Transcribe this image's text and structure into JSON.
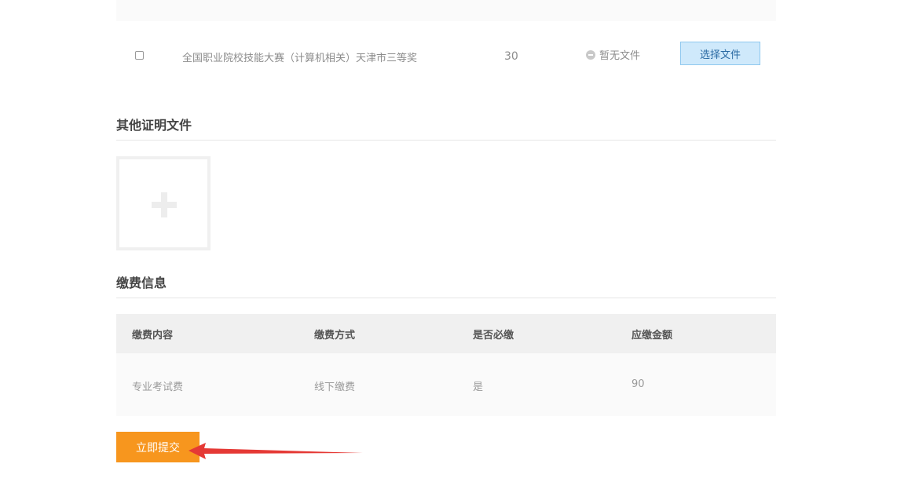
{
  "certificate": {
    "row": {
      "name": "全国职业院校技能大赛（计算机相关）天津市三等奖",
      "score": "30",
      "status": "暂无文件",
      "choose_label": "选择文件"
    }
  },
  "other_docs": {
    "title": "其他证明文件"
  },
  "fee": {
    "title": "缴费信息",
    "headers": [
      "缴费内容",
      "缴费方式",
      "是否必缴",
      "应缴金额"
    ],
    "rows": [
      [
        "专业考试费",
        "线下缴费",
        "是",
        "90"
      ]
    ]
  },
  "submit_label": "立即提交",
  "colors": {
    "submit": "#f7961e",
    "choose_button_bg": "#cfe9fb",
    "annotation_arrow": "#e53935"
  }
}
